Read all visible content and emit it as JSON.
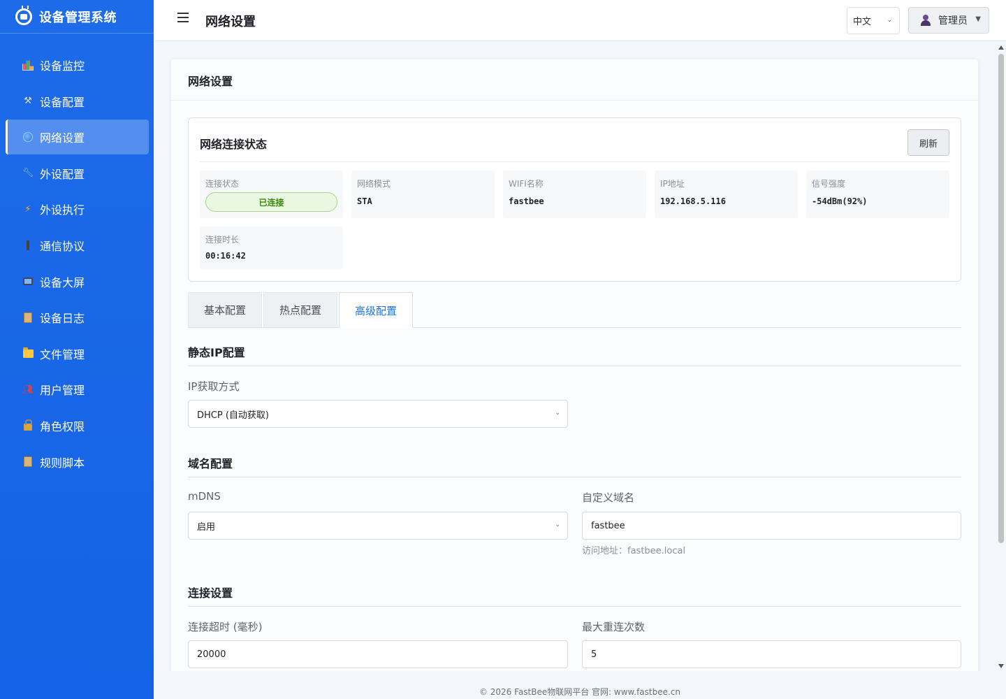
{
  "sidebar": {
    "brand": "设备管理系统",
    "items": [
      {
        "label": "设备监控"
      },
      {
        "label": "设备配置"
      },
      {
        "label": "网络设置"
      },
      {
        "label": "外设配置"
      },
      {
        "label": "外设执行"
      },
      {
        "label": "通信协议"
      },
      {
        "label": "设备大屏"
      },
      {
        "label": "设备日志"
      },
      {
        "label": "文件管理"
      },
      {
        "label": "用户管理"
      },
      {
        "label": "角色权限"
      },
      {
        "label": "规则脚本"
      }
    ],
    "active_index": 2
  },
  "header": {
    "title": "网络设置",
    "language": "中文",
    "user": "管理员"
  },
  "card": {
    "title": "网络设置"
  },
  "status": {
    "title": "网络连接状态",
    "refresh_label": "刷新",
    "connection_label": "连接状态",
    "connection_value": "已连接",
    "mode_label": "网络模式",
    "mode_value": "STA",
    "wifi_label": "WIFI名称",
    "wifi_value": "fastbee",
    "ip_label": "IP地址",
    "ip_value": "192.168.5.116",
    "signal_label": "信号强度",
    "signal_value": "-54dBm(92%)",
    "uptime_label": "连接时长",
    "uptime_value": "00:16:42",
    "connected_color": "#3a8a10"
  },
  "tabs": [
    {
      "label": "基本配置"
    },
    {
      "label": "热点配置"
    },
    {
      "label": "高级配置"
    }
  ],
  "active_tab": 2,
  "static_ip": {
    "title": "静态IP配置",
    "ip_method_label": "IP获取方式",
    "ip_method_value": "DHCP (自动获取)"
  },
  "domain": {
    "title": "域名配置",
    "mdns_label": "mDNS",
    "mdns_value": "启用",
    "custom_label": "自定义域名",
    "custom_value": "fastbee",
    "hint": "访问地址：fastbee.local"
  },
  "connection": {
    "title": "连接设置",
    "timeout_label": "连接超时 (毫秒)",
    "timeout_value": "20000",
    "retries_label": "最大重连次数",
    "retries_value": "5"
  },
  "footer": {
    "text": "© 2026 FastBee物联网平台 官网: www.fastbee.cn"
  },
  "colors": {
    "sidebar": "#1463e6",
    "accent": "#1a73e8"
  }
}
